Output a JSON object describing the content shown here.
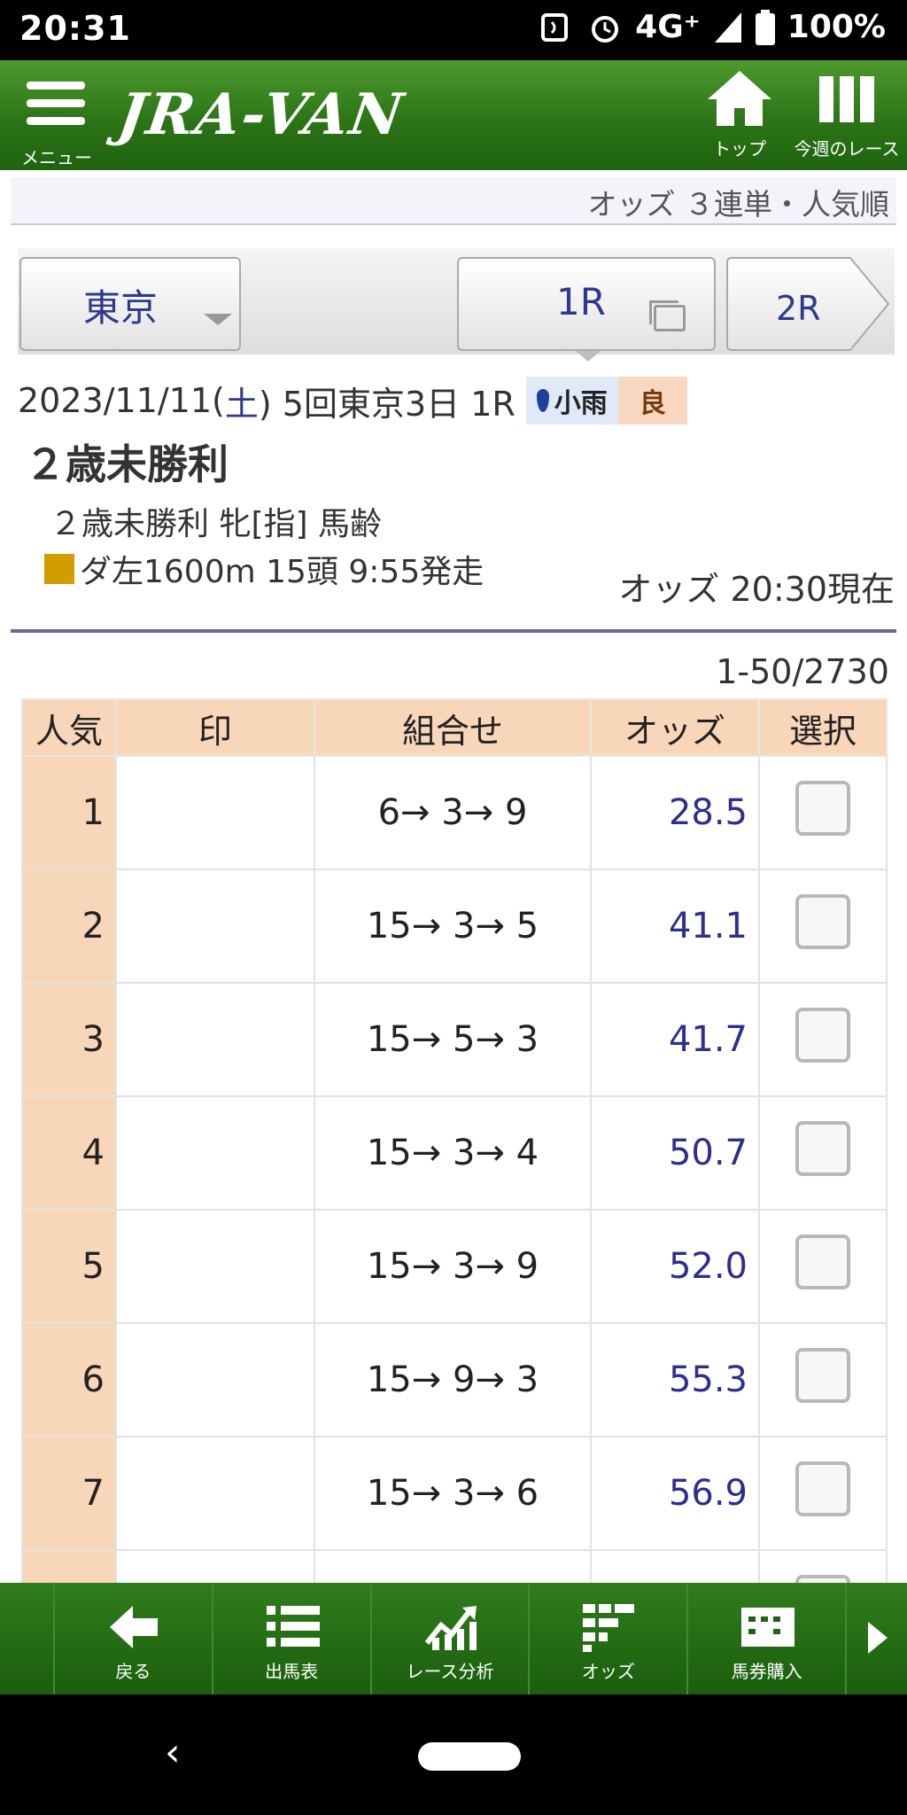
{
  "status_bar": {
    "time": "20:31",
    "network": "4G⁺",
    "battery": "100%"
  },
  "header": {
    "menu_label": "メニュー",
    "logo": "JRA-VAN",
    "top_label": "トップ",
    "week_label": "今週のレース"
  },
  "subtitle": "オッズ ３連単・人気順",
  "selector": {
    "venue": "東京",
    "race": "1R",
    "next_race": "2R"
  },
  "race": {
    "date": "2023/11/11(",
    "weekday": "土",
    "meeting": ") 5回東京3日 1R",
    "weather": "小雨",
    "track_condition": "良",
    "title": "２歳未勝利",
    "conditions": "２歳未勝利 牝[指] 馬齢",
    "distance": "ダ左1600m 15頭 9:55発走",
    "odds_time": "オッズ 20:30現在"
  },
  "range": "1-50/2730",
  "table": {
    "headers": [
      "人気",
      "印",
      "組合せ",
      "オッズ",
      "選択"
    ],
    "rows": [
      {
        "rank": "1",
        "mark": "",
        "combo": "6→ 3→ 9",
        "odds": "28.5"
      },
      {
        "rank": "2",
        "mark": "",
        "combo": "15→ 3→ 5",
        "odds": "41.1"
      },
      {
        "rank": "3",
        "mark": "",
        "combo": "15→ 5→ 3",
        "odds": "41.7"
      },
      {
        "rank": "4",
        "mark": "",
        "combo": "15→ 3→ 4",
        "odds": "50.7"
      },
      {
        "rank": "5",
        "mark": "",
        "combo": "15→ 3→ 9",
        "odds": "52.0"
      },
      {
        "rank": "6",
        "mark": "",
        "combo": "15→ 9→ 3",
        "odds": "55.3"
      },
      {
        "rank": "7",
        "mark": "",
        "combo": "15→ 3→ 6",
        "odds": "56.9"
      },
      {
        "rank": "",
        "mark": "",
        "combo": "",
        "odds": ""
      }
    ]
  },
  "bottom_nav": {
    "back": "戻る",
    "entries": "出馬表",
    "analysis": "レース分析",
    "odds": "オッズ",
    "purchase": "馬券購入"
  },
  "colors": {
    "header_green": "#2c7416",
    "accent_navy": "#2d2f8f",
    "rank_bg": "#f8d6b9",
    "divider": "#6b65a3"
  },
  "icons": [
    "nfc-icon",
    "alarm-icon",
    "signal-icon",
    "battery-icon",
    "menu-icon",
    "home-icon",
    "columns-icon",
    "dropdown-caret-icon",
    "window-icon",
    "back-arrow-icon",
    "list-icon",
    "chart-icon",
    "grid-icon",
    "ticket-icon",
    "chevron-right-icon"
  ]
}
